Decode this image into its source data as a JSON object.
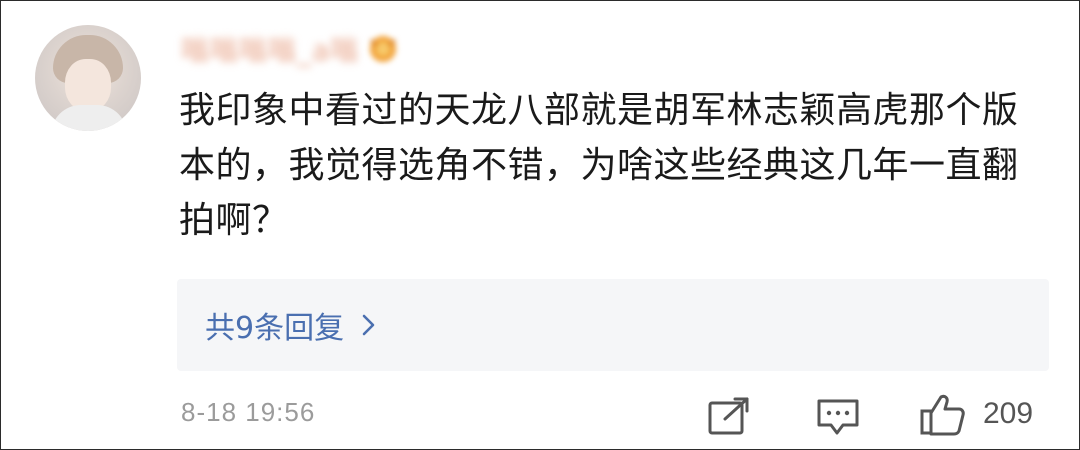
{
  "comment": {
    "username": "嗡嗡嗡嗡_a嗡",
    "text": "我印象中看过的天龙八部就是胡军林志颖高虎那个版本的，我觉得选角不错，为啥这些经典这几年一直翻拍啊？",
    "replies_label": "共9条回复",
    "timestamp": "8-18 19:56",
    "like_count": "209"
  },
  "icons": {
    "avatar": "avatar-photo",
    "vip": "vip-badge-icon",
    "replies_chevron": "chevron-right-icon",
    "share": "share-icon",
    "comment": "comment-icon",
    "like": "thumbs-up-icon"
  },
  "colors": {
    "text": "#1a1a1a",
    "link": "#4a6fb0",
    "meta": "#9b9b9b",
    "reply_bg": "#f5f6f8",
    "username_blur": "#e8a58a"
  }
}
